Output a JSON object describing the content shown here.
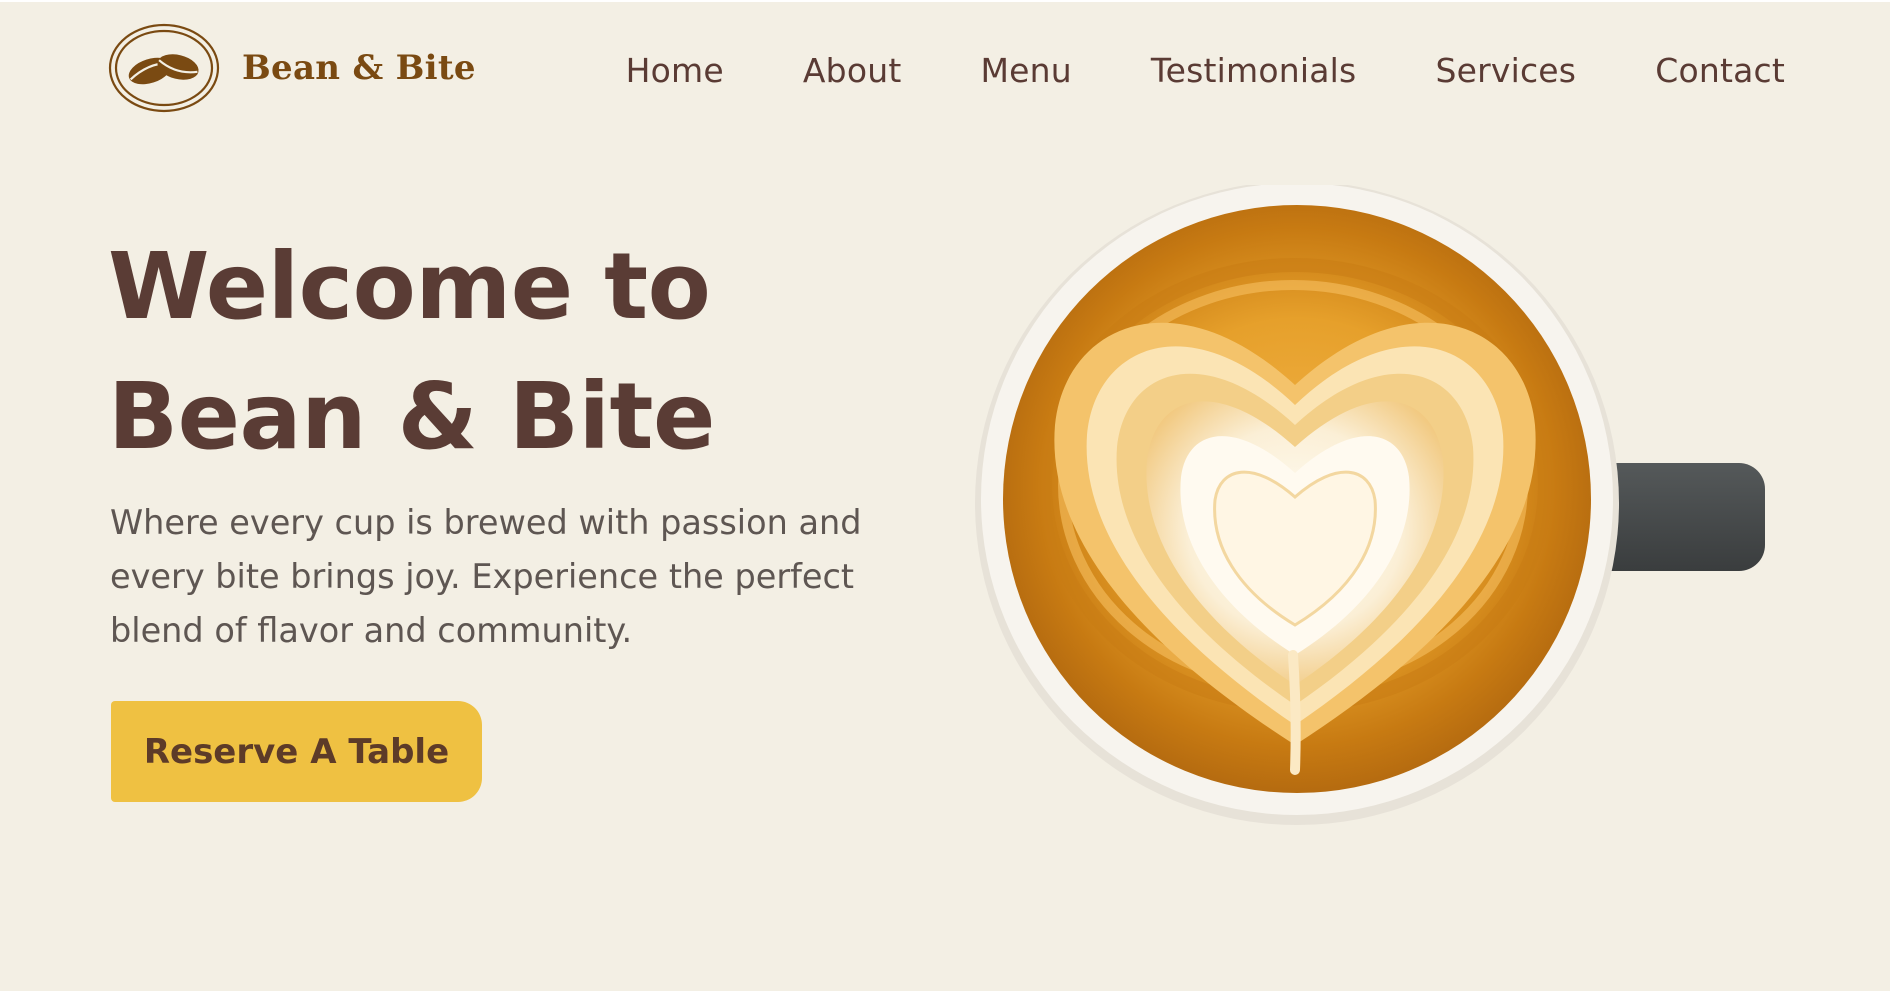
{
  "brand": {
    "name": "Bean & Bite",
    "color": "#7a4a12"
  },
  "nav": {
    "items": [
      {
        "label": "Home"
      },
      {
        "label": "About"
      },
      {
        "label": "Menu"
      },
      {
        "label": "Testimonials"
      },
      {
        "label": "Services"
      },
      {
        "label": "Contact"
      }
    ]
  },
  "hero": {
    "title_line1": "Welcome to",
    "title_line2": "Bean & Bite",
    "subtitle": "Where every cup is brewed with passion and every bite brings joy. Experience the perfect blend of flavor and community.",
    "cta_label": "Reserve A Table",
    "image_icon": "latte-heart-cup-image"
  },
  "colors": {
    "background": "#f3efe4",
    "heading": "#5a3c35",
    "accent": "#efc142",
    "nav_text": "#5a3b34"
  }
}
